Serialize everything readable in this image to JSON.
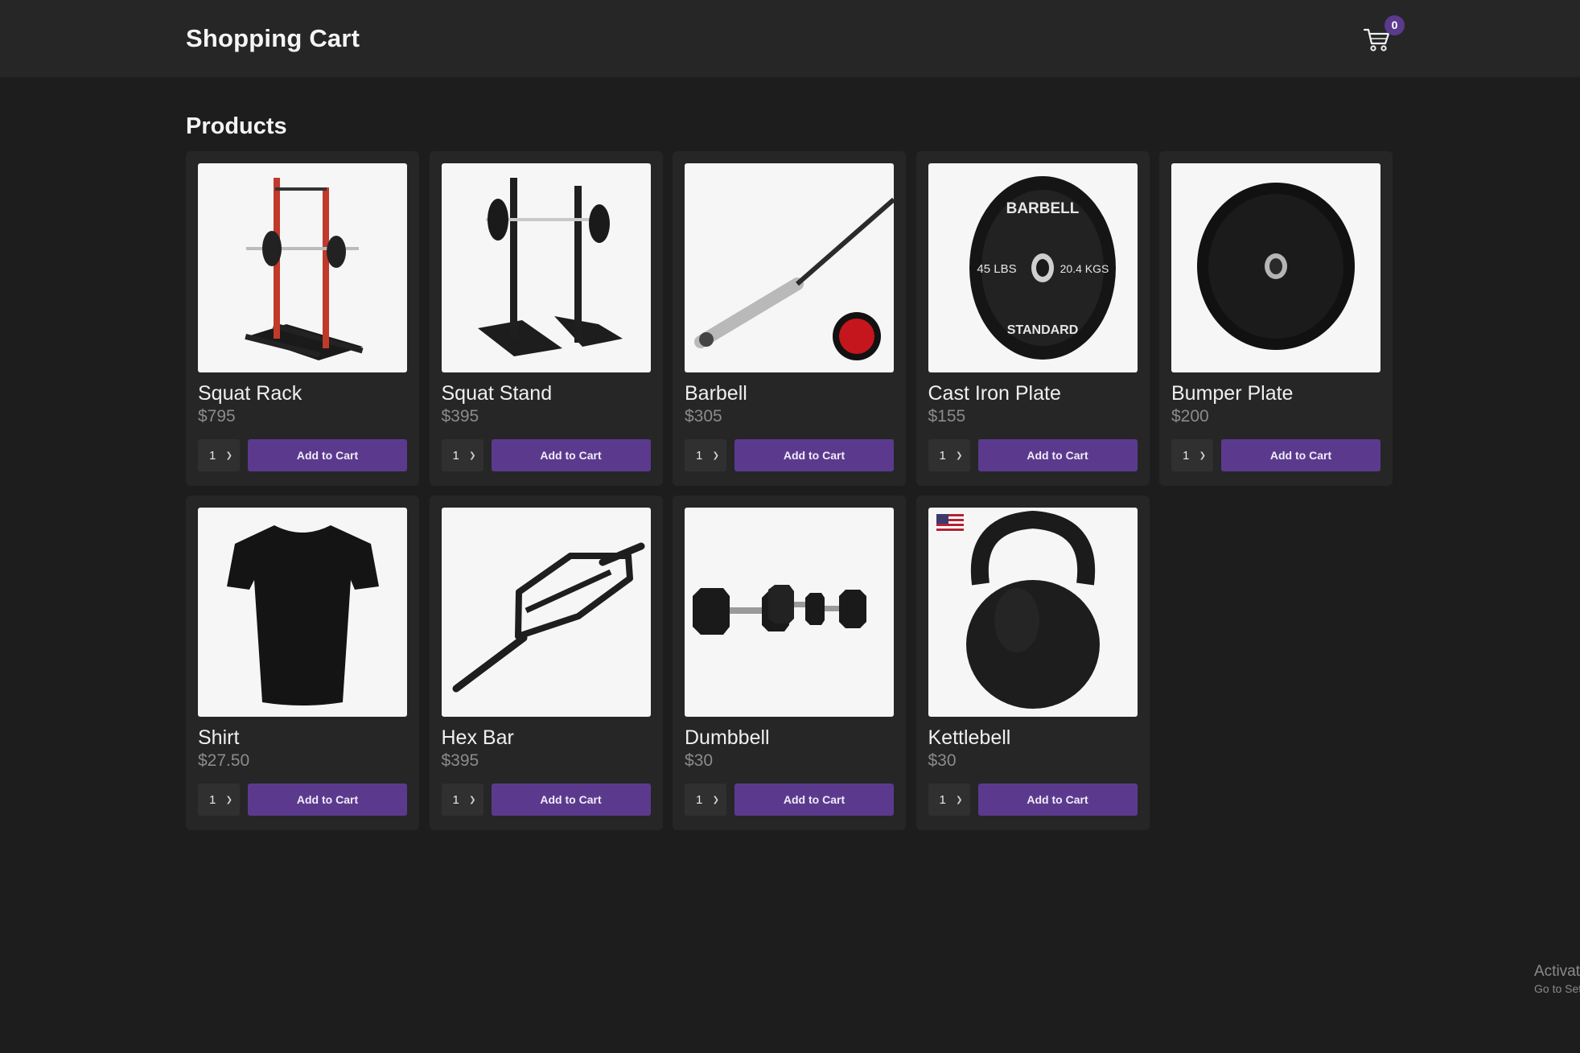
{
  "header": {
    "title": "Shopping Cart",
    "cart_count": "0",
    "cart_icon": "shopping-cart-icon"
  },
  "section_title": "Products",
  "colors": {
    "accent": "#5b3a8e",
    "background": "#1d1d1e",
    "card": "#262627",
    "price_text": "#8b8b8b"
  },
  "products": [
    {
      "name": "Squat Rack",
      "price": "$795",
      "qty": "1",
      "button": "Add to Cart",
      "image_icon": "squat-rack-image"
    },
    {
      "name": "Squat Stand",
      "price": "$395",
      "qty": "1",
      "button": "Add to Cart",
      "image_icon": "squat-stand-image"
    },
    {
      "name": "Barbell",
      "price": "$305",
      "qty": "1",
      "button": "Add to Cart",
      "image_icon": "barbell-image"
    },
    {
      "name": "Cast Iron Plate",
      "price": "$155",
      "qty": "1",
      "button": "Add to Cart",
      "image_icon": "cast-iron-plate-image",
      "plate_text": {
        "top": "BARBELL",
        "left": "45 LBS",
        "right": "20.4 KGS",
        "bottom": "STANDARD"
      }
    },
    {
      "name": "Bumper Plate",
      "price": "$200",
      "qty": "1",
      "button": "Add to Cart",
      "image_icon": "bumper-plate-image"
    },
    {
      "name": "Shirt",
      "price": "$27.50",
      "qty": "1",
      "button": "Add to Cart",
      "image_icon": "shirt-image"
    },
    {
      "name": "Hex Bar",
      "price": "$395",
      "qty": "1",
      "button": "Add to Cart",
      "image_icon": "hex-bar-image"
    },
    {
      "name": "Dumbbell",
      "price": "$30",
      "qty": "1",
      "button": "Add to Cart",
      "image_icon": "dumbbell-image"
    },
    {
      "name": "Kettlebell",
      "price": "$30",
      "qty": "1",
      "button": "Add to Cart",
      "image_icon": "kettlebell-image"
    }
  ],
  "watermark": {
    "line1": "Activate Windows",
    "line2": "Go to Settings to activate Windows."
  }
}
